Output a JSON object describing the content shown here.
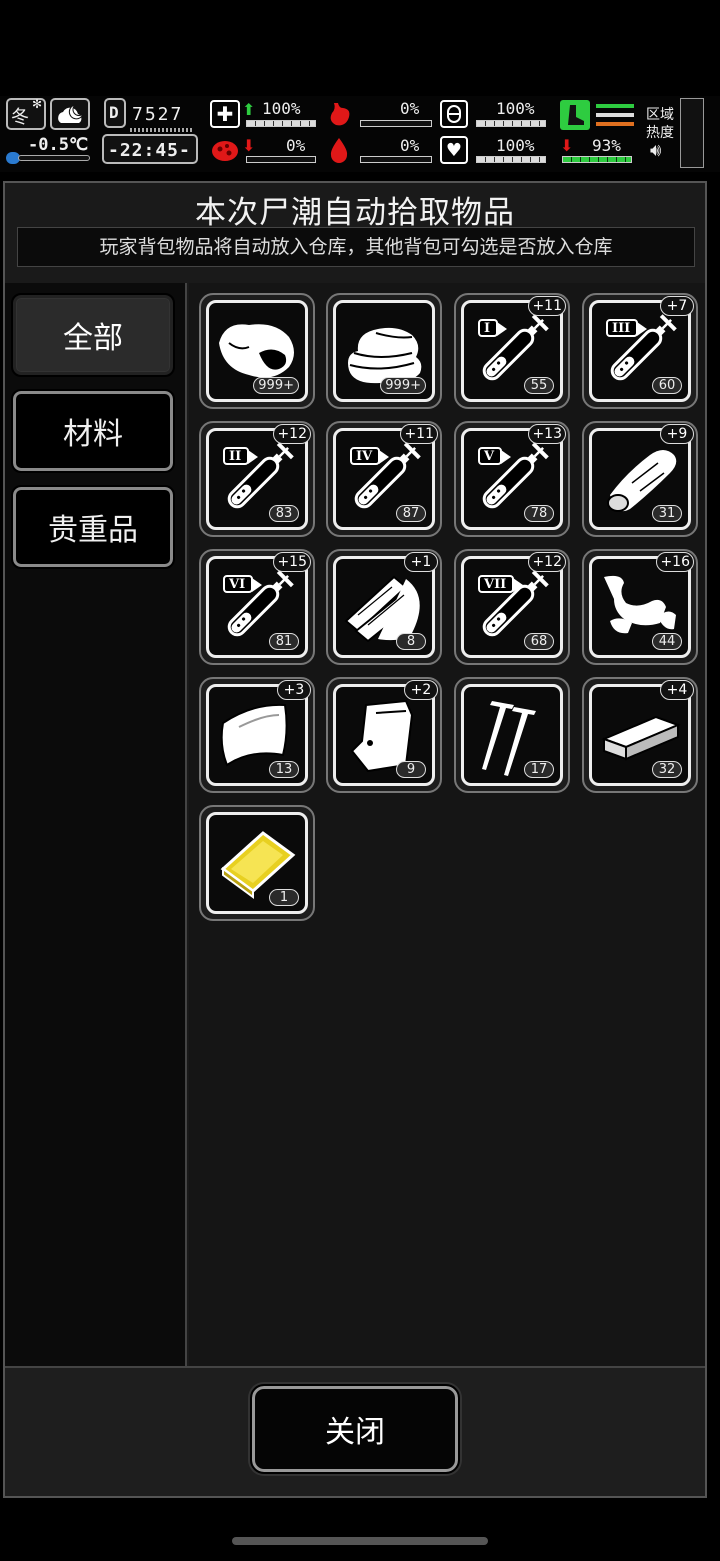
{
  "hud": {
    "season": "冬",
    "temperature": "-0.5℃",
    "day_counter": "7527",
    "clock": "-22:45-",
    "health_pct": "100%",
    "hunger_pct": "0%",
    "armor_pct": "100%",
    "infection_pct": "0%",
    "bleeding_pct": "0%",
    "mood_pct": "100%",
    "stamina_pct": "93%",
    "zone_label_1": "区域",
    "zone_label_2": "热度"
  },
  "dialog": {
    "title": "本次尸潮自动拾取物品",
    "subtitle": "玩家背包物品将自动放入仓库，其他背包可勾选是否放入仓库",
    "tabs": [
      {
        "label": "全部",
        "active": true
      },
      {
        "label": "材料",
        "active": false
      },
      {
        "label": "贵重品",
        "active": false
      }
    ],
    "close_label": "关闭"
  },
  "items": [
    {
      "icon": "meat-icon",
      "count": "999+",
      "bonus": "",
      "tier": ""
    },
    {
      "icon": "cloth-icon",
      "count": "999+",
      "bonus": "",
      "tier": ""
    },
    {
      "icon": "syringe-icon",
      "count": "55",
      "bonus": "+11",
      "tier": "I"
    },
    {
      "icon": "syringe-icon",
      "count": "60",
      "bonus": "+7",
      "tier": "III"
    },
    {
      "icon": "syringe-icon",
      "count": "83",
      "bonus": "+12",
      "tier": "II"
    },
    {
      "icon": "syringe-icon",
      "count": "87",
      "bonus": "+11",
      "tier": "IV"
    },
    {
      "icon": "syringe-icon",
      "count": "78",
      "bonus": "+13",
      "tier": "V"
    },
    {
      "icon": "wood-log-icon",
      "count": "31",
      "bonus": "+9",
      "tier": ""
    },
    {
      "icon": "syringe-icon",
      "count": "81",
      "bonus": "+15",
      "tier": "VI"
    },
    {
      "icon": "wood-planks-icon",
      "count": "8",
      "bonus": "+1",
      "tier": ""
    },
    {
      "icon": "syringe-icon",
      "count": "68",
      "bonus": "+12",
      "tier": "VII"
    },
    {
      "icon": "scrap-metal-icon",
      "count": "44",
      "bonus": "+16",
      "tier": ""
    },
    {
      "icon": "metal-sheet-icon",
      "count": "13",
      "bonus": "+3",
      "tier": ""
    },
    {
      "icon": "plastic-bag-icon",
      "count": "9",
      "bonus": "+2",
      "tier": ""
    },
    {
      "icon": "nails-icon",
      "count": "17",
      "bonus": "",
      "tier": ""
    },
    {
      "icon": "brick-icon",
      "count": "32",
      "bonus": "+4",
      "tier": ""
    },
    {
      "icon": "gold-bar-icon",
      "count": "1",
      "bonus": "",
      "tier": ""
    }
  ],
  "colors": {
    "background": "#000000",
    "panel": "#1a1a1a",
    "sidebar": "#0b0b0b",
    "accent_green": "#2ecc40",
    "alert_red": "#e01818",
    "gold": "#e8d020"
  }
}
